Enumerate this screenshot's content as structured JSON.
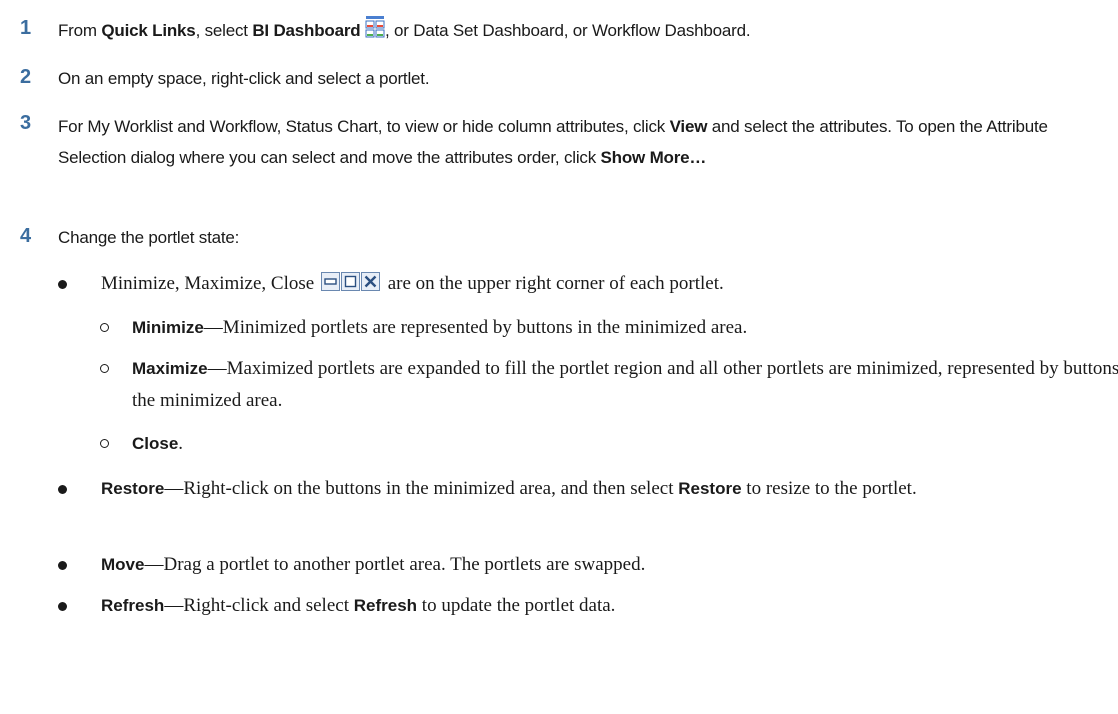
{
  "steps": [
    {
      "num": "1",
      "pre": "From ",
      "quick_links": "Quick Links",
      "mid": ", select ",
      "bi_dashboard": "BI Dashboard",
      "post": ", or Data Set Dashboard, or Workflow Dashboard."
    },
    {
      "num": "2",
      "text": "On an empty space, right-click and select a portlet."
    },
    {
      "num": "3",
      "pre": "For My Worklist and Workflow, Status Chart, to view or hide column attributes, click ",
      "view": "View",
      "mid": " and select the attributes. To open the Attribute Selection dialog where you can select and move the attributes order, click ",
      "show_more": "Show More…"
    },
    {
      "num": "4",
      "text": "Change the portlet state:"
    }
  ],
  "bullets": {
    "state_icons": {
      "pre": "Minimize, Maximize, Close",
      "post": "are on the upper right corner of each portlet."
    },
    "minimize": {
      "term": "Minimize",
      "text": "—Minimized portlets are represented by buttons in the minimized area."
    },
    "maximize": {
      "term": "Maximize",
      "text": "—Maximized portlets are expanded to fill the portlet region and all other portlets are minimized, represented by buttons in the minimized area."
    },
    "close": {
      "term": "Close",
      "text": "."
    },
    "restore": {
      "term": "Restore",
      "pre": "—Right-click on the buttons in the minimized area, and then select ",
      "term2": "Restore",
      "post": " to resize to the portlet."
    },
    "move": {
      "term": "Move",
      "text": "—Drag a portlet to another portlet area. The portlets are swapped."
    },
    "refresh": {
      "term": "Refresh",
      "pre": "—Right-click and select ",
      "term2": "Refresh",
      "post": " to update the portlet data."
    }
  },
  "colors": {
    "step_number": "#3b6d9f",
    "text": "#1a1a1a"
  },
  "icons": [
    "bi-dashboard-icon",
    "minimize-icon",
    "maximize-icon",
    "close-icon"
  ]
}
